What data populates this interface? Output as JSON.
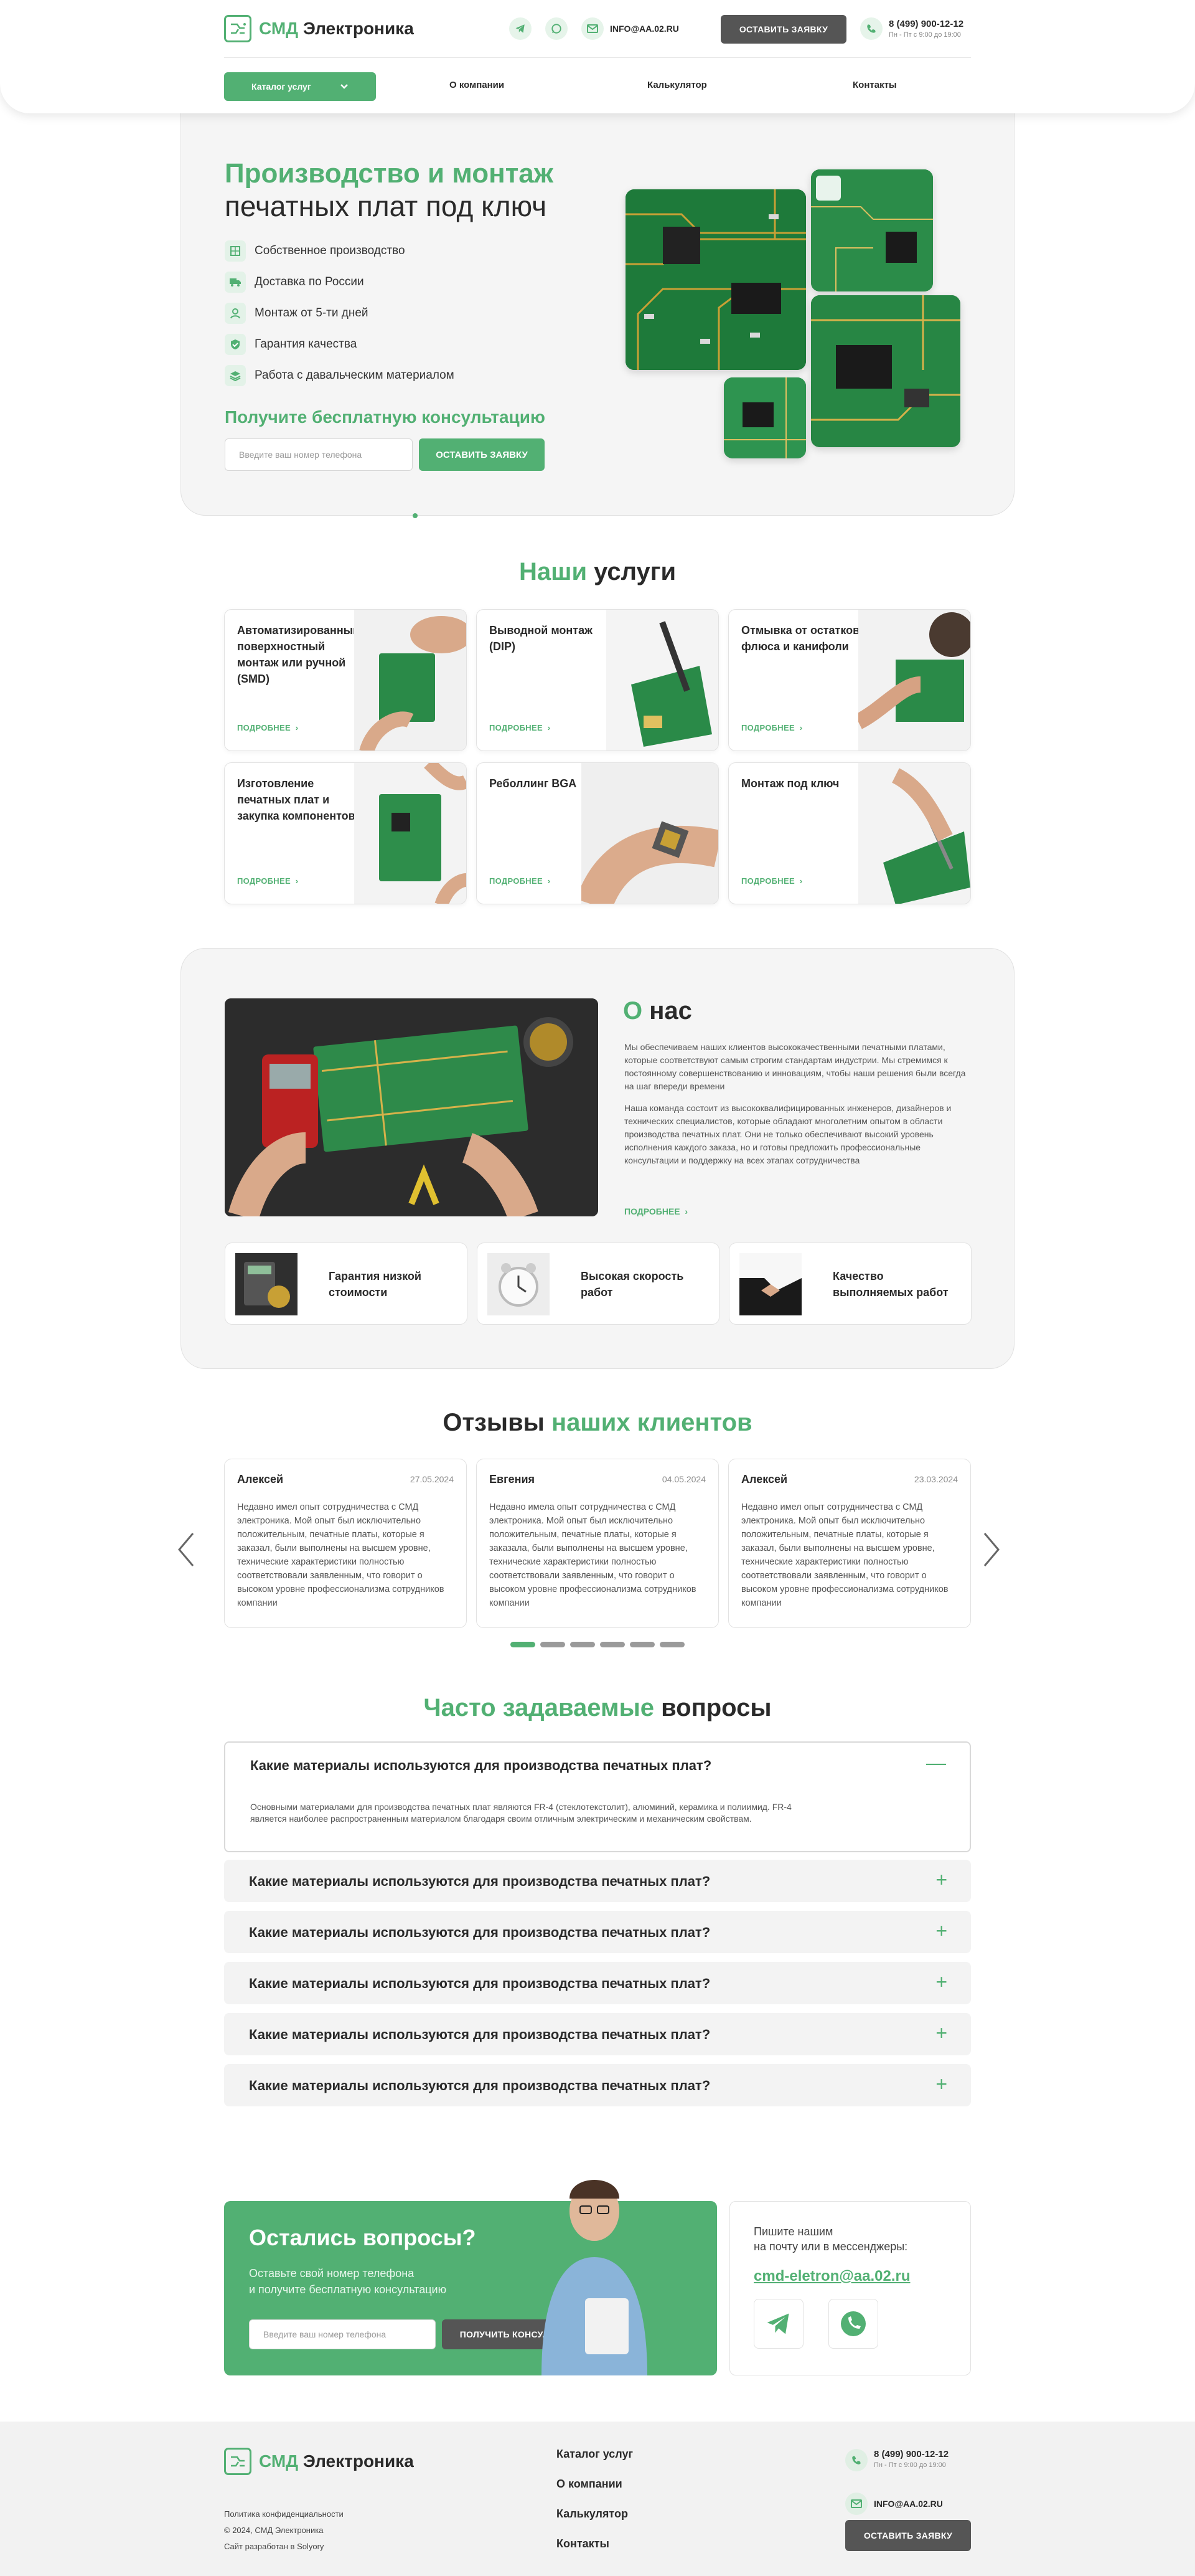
{
  "header": {
    "logo_abbr": "СМД",
    "logo_name": "Электроника",
    "email": "INFO@AA.02.RU",
    "cta": "ОСТАВИТЬ ЗАЯВКУ",
    "phone": "8 (499) 900-12-12",
    "hours": "Пн - Пт с 9:00 до 19:00",
    "nav": {
      "catalog": "Каталог услуг",
      "about": "О компании",
      "calc": "Калькулятор",
      "contacts": "Контакты"
    }
  },
  "hero": {
    "title_green": "Производство и монтаж",
    "title_rest": "печатных плат под ключ",
    "features": [
      "Собственное производство",
      "Доставка по России",
      "Монтаж от 5-ти дней",
      "Гарантия качества",
      "Работа с давальческим материалом"
    ],
    "consult_title": "Получите бесплатную консультацию",
    "phone_placeholder": "Введите ваш номер телефона",
    "button": "ОСТАВИТЬ ЗАЯВКУ"
  },
  "services": {
    "title_green": "Наши",
    "title_rest": "услуги",
    "more": "ПОДРОБНЕЕ",
    "items": [
      "Автоматизированный поверхностный монтаж или ручной (SMD)",
      "Выводной монтаж (DIP)",
      "Отмывка от остатков флюса и канифоли",
      "Изготовление печатных плат и закупка компонентов",
      "Реболлинг BGA",
      "Монтаж под ключ"
    ]
  },
  "about": {
    "title_green": "О",
    "title_rest": "нас",
    "p1": "Мы обеспечиваем наших клиентов высококачественными печатными платами, которые соответствуют самым строгим стандартам индустрии. Мы стремимся к постоянному совершенствованию и инновациям, чтобы наши решения были всегда на шаг впереди времени",
    "p2": "Наша команда состоит из высококвалифицированных инженеров, дизайнеров и технических специалистов, которые обладают многолетним опытом в области производства печатных плат. Они не только обеспечивают высокий уровень исполнения каждого заказа, но и готовы предложить профессиональные консультации и поддержку на всех этапах сотрудничества",
    "more": "ПОДРОБНЕЕ",
    "cards": [
      "Гарантия низкой стоимости",
      "Высокая скорость работ",
      "Качество выполняемых работ"
    ]
  },
  "reviews": {
    "title_rest": "Отзывы",
    "title_green": "наших клиентов",
    "items": [
      {
        "name": "Алексей",
        "date": "27.05.2024",
        "text": "Недавно имел опыт сотрудничества с СМД электроника. Мой опыт был исключительно положительным, печатные платы, которые я заказал, были выполнены на высшем уровне, технические характеристики полностью соответствовали заявленным, что говорит о высоком уровне профессионализма сотрудников компании"
      },
      {
        "name": "Евгения",
        "date": "04.05.2024",
        "text": "Недавно имела опыт сотрудничества с СМД электроника. Мой опыт был исключительно положительным, печатные платы, которые я заказала, были выполнены на высшем уровне, технические характеристики полностью соответствовали заявленным, что говорит о высоком уровне профессионализма сотрудников компании"
      },
      {
        "name": "Алексей",
        "date": "23.03.2024",
        "text": "Недавно имел опыт сотрудничества с СМД электроника. Мой опыт был исключительно положительным, печатные платы, которые я заказал, были выполнены на высшем уровне, технические характеристики полностью соответствовали заявленным, что говорит о высоком уровне профессионализма сотрудников компании"
      }
    ]
  },
  "faq": {
    "title_green": "Часто задаваемые",
    "title_rest": "вопросы",
    "question": "Какие материалы используются для производства печатных плат?",
    "answer": "Основными материалами для производства печатных плат являются FR-4 (стеклотекстолит), алюминий, керамика и полиимид. FR-4 является наиболее распространенным материалом благодаря своим отличным электрическим и механическим свойствам."
  },
  "cta": {
    "title": "Остались вопросы?",
    "sub1": "Оставьте свой номер телефона",
    "sub2": "и получите бесплатную консультацию",
    "placeholder": "Введите ваш номер телефона",
    "button": "ПОЛУЧИТЬ КОНСУЛЬТАЦИЮ",
    "write1": "Пишите нашим",
    "write2": "на почту или в мессенджеры:",
    "email": "cmd-eletron@aa.02.ru"
  },
  "footer": {
    "logo_abbr": "СМД",
    "logo_name": "Электроника",
    "privacy": "Политика конфиденциальности",
    "copyright": "© 2024, СМД Электроника",
    "dev": "Сайт разработан в Solyory",
    "links": [
      "Каталог услуг",
      "О компании",
      "Калькулятор",
      "Контакты"
    ],
    "phone": "8 (499) 900-12-12",
    "hours": "Пн - Пт с 9:00 до 19:00",
    "email": "INFO@AA.02.RU",
    "button": "ОСТАВИТЬ ЗАЯВКУ"
  }
}
